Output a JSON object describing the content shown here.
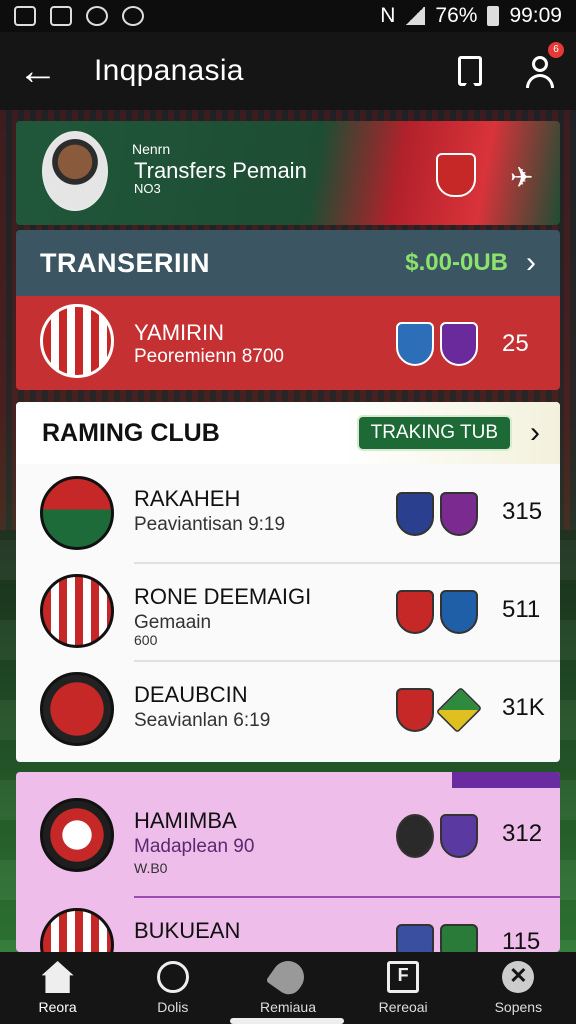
{
  "statusbar": {
    "left_icons": [
      "gallery-icon",
      "image-icon",
      "o-app-icon",
      "g-app-icon"
    ],
    "network": "N",
    "battery": "76%",
    "time": "99:09"
  },
  "appbar": {
    "back_glyph": "←",
    "title": "Inqpanasia",
    "notification_count": "6"
  },
  "hero": {
    "small_label": "Nenrn",
    "title": "Transfers Pemain",
    "subtitle": "NO3"
  },
  "transfer": {
    "title": "TRANSERIIN",
    "amount": "$.00-0UB",
    "club_name": "YAMIRIN",
    "club_sub": "Peoremienn 8700",
    "value": "25"
  },
  "ranking": {
    "title": "RAMING CLUB",
    "pill": "TRAKING TUB",
    "rows": [
      {
        "name": "RAKAHEH",
        "sub": "Peaviantisan 9:19",
        "sub2": "",
        "value": "315"
      },
      {
        "name": "RONE DEEMAIGI",
        "sub": "Gemaain",
        "sub2": "600",
        "value": "511"
      },
      {
        "name": "DEAUBCIN",
        "sub": "Seavianlan 6:19",
        "sub2": "",
        "value": "31K"
      }
    ]
  },
  "pink": {
    "rows": [
      {
        "name": "HAMIMBA",
        "sub": "Madaplean 90",
        "sub2": "W.B0",
        "value": "312"
      },
      {
        "name": "BUKUEAN",
        "sub": "",
        "sub2": "",
        "value": "115"
      }
    ]
  },
  "bottomnav": {
    "items": [
      {
        "label": "Reora",
        "icon": "home-icon"
      },
      {
        "label": "Dolis",
        "icon": "circle-icon"
      },
      {
        "label": "Remiaua",
        "icon": "pen-icon"
      },
      {
        "label": "Rereoai",
        "icon": "f-icon"
      },
      {
        "label": "Sopens",
        "icon": "x-icon"
      }
    ]
  },
  "colors": {
    "hero_green": "#1e4d33",
    "transfer_header": "#3b5563",
    "transfer_body": "#c53033",
    "amount_green": "#8be36b",
    "pill_green": "#1d6a36",
    "pink_card": "#eebdea"
  }
}
